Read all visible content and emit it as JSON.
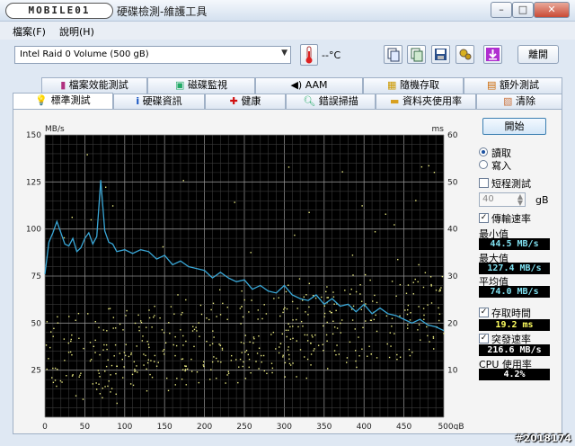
{
  "window": {
    "logo_text": "MOBILE01",
    "title": "硬碟檢測-維護工具",
    "minimize": "–",
    "maximize": "□",
    "close": "✕"
  },
  "menu": [
    {
      "label": "檔案(F)"
    },
    {
      "label": "說明(H)"
    }
  ],
  "toolbar": {
    "drive": "Intel Raid 0 Volume (500 gB)",
    "temperature": "--°C",
    "exit_label": "離開"
  },
  "tabs_top": [
    {
      "label": "檔案效能測試"
    },
    {
      "label": "磁碟監視"
    },
    {
      "label": "AAM"
    },
    {
      "label": "隨機存取"
    },
    {
      "label": "額外測試"
    }
  ],
  "tabs_bottom": [
    {
      "label": "標準測試",
      "active": true
    },
    {
      "label": "硬碟資訊"
    },
    {
      "label": "健康"
    },
    {
      "label": "錯誤掃描"
    },
    {
      "label": "資料夾使用率"
    },
    {
      "label": "清除"
    }
  ],
  "side": {
    "start_label": "開始",
    "read_label": "讀取",
    "write_label": "寫入",
    "short_test_label": "短程測試",
    "short_value": "40",
    "short_unit": "gB",
    "transfer_label": "傳輸速率",
    "min_label": "最小值",
    "min_value": "44.5 MB/s",
    "max_label": "最大值",
    "max_value": "127.4 MB/s",
    "avg_label": "平均值",
    "avg_value": "74.0 MB/s",
    "access_label": "存取時間",
    "access_value": "19.2 ms",
    "burst_label": "突發速率",
    "burst_value": "216.6 MB/s",
    "cpu_label": "CPU 使用率",
    "cpu_value": "4.2%"
  },
  "watermark": "#2018174",
  "colors": {
    "transfer_line": "#3aa8d8",
    "access_dots": "#e8e880",
    "plot_bg": "#000000"
  },
  "chart_data": {
    "type": "line",
    "y_left_label": "MB/s",
    "y_right_label": "ms",
    "x_unit": "gB",
    "xlim": [
      0,
      500
    ],
    "ylim_left": [
      0,
      150
    ],
    "ylim_right": [
      0,
      60
    ],
    "x_ticks": [
      0,
      50,
      100,
      150,
      200,
      250,
      300,
      350,
      400,
      450,
      500
    ],
    "x_tick_labels": [
      "0",
      "50",
      "100",
      "150",
      "200",
      "250",
      "300",
      "350",
      "400",
      "450",
      "500gB"
    ],
    "y_left_ticks": [
      25,
      50,
      75,
      100,
      125,
      150
    ],
    "y_right_ticks": [
      10,
      20,
      30,
      40,
      50,
      60
    ],
    "grid": true,
    "series": [
      {
        "name": "傳輸速率",
        "axis": "left",
        "x": [
          0,
          5,
          10,
          15,
          20,
          25,
          30,
          35,
          40,
          45,
          50,
          55,
          60,
          65,
          70,
          75,
          80,
          85,
          90,
          100,
          110,
          120,
          130,
          140,
          150,
          160,
          170,
          180,
          190,
          200,
          210,
          220,
          230,
          240,
          250,
          260,
          270,
          280,
          290,
          300,
          310,
          320,
          330,
          340,
          350,
          360,
          370,
          380,
          390,
          400,
          410,
          420,
          430,
          440,
          450,
          460,
          470,
          480,
          490,
          500
        ],
        "y": [
          76,
          93,
          98,
          104,
          98,
          92,
          91,
          95,
          88,
          90,
          95,
          98,
          92,
          96,
          126,
          99,
          93,
          92,
          88,
          89,
          87,
          89,
          88,
          84,
          86,
          81,
          83,
          80,
          79,
          78,
          74,
          77,
          74,
          72,
          73,
          68,
          70,
          67,
          66,
          70,
          65,
          63,
          62,
          65,
          60,
          63,
          59,
          60,
          56,
          60,
          55,
          58,
          55,
          54,
          52,
          50,
          52,
          49,
          48,
          46
        ]
      },
      {
        "name": "存取時間",
        "axis": "right",
        "type": "scatter",
        "note_points": "random-spread",
        "center_ms": 19.2
      }
    ]
  }
}
